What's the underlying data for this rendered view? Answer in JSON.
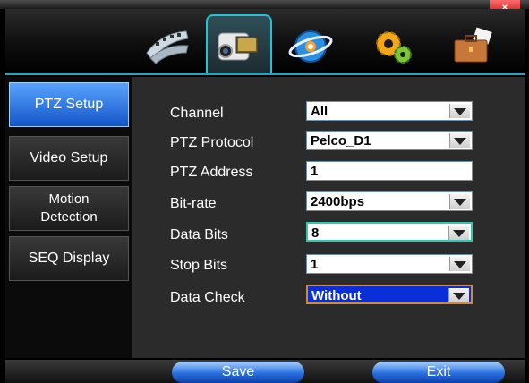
{
  "window": {
    "close_label": "×"
  },
  "top_tabs": [
    {
      "name": "video-tab",
      "icon": "film-reel-icon"
    },
    {
      "name": "camera-tab",
      "icon": "camcorder-icon",
      "active": true
    },
    {
      "name": "network-tab",
      "icon": "globe-icon"
    },
    {
      "name": "settings-tab",
      "icon": "gears-icon"
    },
    {
      "name": "tools-tab",
      "icon": "briefcase-icon"
    }
  ],
  "sidebar": {
    "items": [
      {
        "label": "PTZ Setup",
        "active": true
      },
      {
        "label": "Video Setup"
      },
      {
        "label_line1": "Motion",
        "label_line2": "Detection"
      },
      {
        "label": "SEQ Display"
      }
    ]
  },
  "form": {
    "channel": {
      "label": "Channel",
      "value": "All"
    },
    "ptz_protocol": {
      "label": "PTZ Protocol",
      "value": "Pelco_D1"
    },
    "ptz_address": {
      "label": "PTZ Address",
      "value": "1"
    },
    "bit_rate": {
      "label": "Bit-rate",
      "value": "2400bps"
    },
    "data_bits": {
      "label": "Data Bits",
      "value": "8"
    },
    "stop_bits": {
      "label": "Stop Bits",
      "value": "1"
    },
    "data_check": {
      "label": "Data Check",
      "value": "Without"
    }
  },
  "buttons": {
    "save": "Save",
    "exit": "Exit"
  },
  "colors": {
    "accent": "#1ea7bd",
    "active_blue": "#1253c7",
    "selection": "#0a2fd9"
  }
}
